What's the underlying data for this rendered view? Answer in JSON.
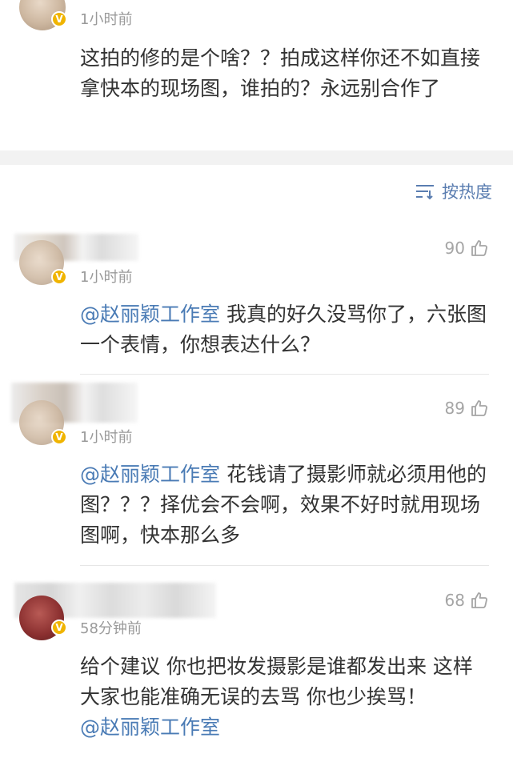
{
  "top_comment": {
    "time": "1小时前",
    "text": "这拍的修的是个啥？？拍成这样你还不如直接拿快本的现场图，谁拍的？永远别合作了"
  },
  "sort": {
    "label": "按热度",
    "icon": "sort-lines-icon"
  },
  "comments": [
    {
      "time": "1小时前",
      "likes": "90",
      "mention": "@赵丽颖工作室",
      "text": " 我真的好久没骂你了，六张图一个表情，你想表达什么？"
    },
    {
      "time": "1小时前",
      "likes": "89",
      "mention": "@赵丽颖工作室",
      "text": " 花钱请了摄影师就必须用他的图？？？择优会不会啊，效果不好时就用现场图啊，快本那么多"
    },
    {
      "time": "58分钟前",
      "likes": "68",
      "text": "给个建议 你也把妆发摄影是谁都发出来 这样大家也能准确无误的去骂 你也少挨骂！",
      "mention_after": "@赵丽颖工作室"
    }
  ],
  "colors": {
    "mention": "#4a7bb5",
    "badge": "#f0b400",
    "band": "#f2f2f2",
    "muted": "#9a9a9a"
  }
}
